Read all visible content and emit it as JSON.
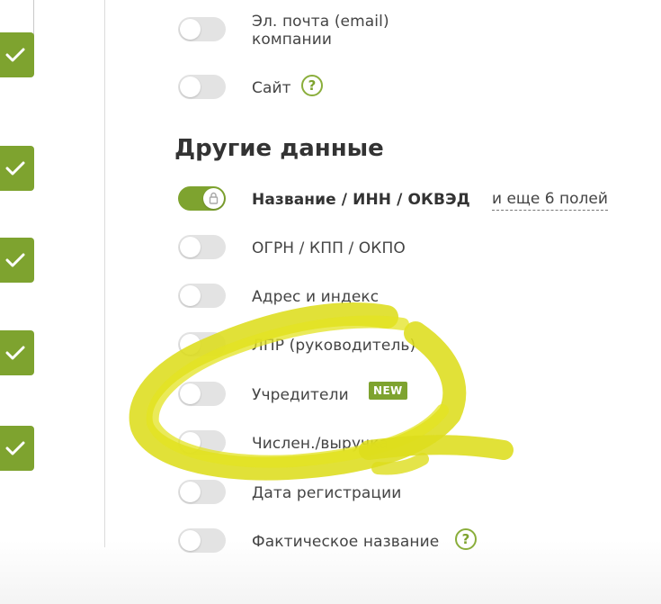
{
  "toggles_top": [
    {
      "label": "Эл. почта (email) компании",
      "on": false
    },
    {
      "label": "Сайт",
      "on": false,
      "help": "?"
    }
  ],
  "section": {
    "title": "Другие данные"
  },
  "items": [
    {
      "label": "Название / ИНН / ОКВЭД",
      "on": true,
      "locked": true
    },
    {
      "label": "ОГРН / КПП / ОКПО",
      "on": false
    },
    {
      "label": "Адрес и индекс",
      "on": false
    },
    {
      "label": "ЛПР (руководитель)",
      "on": false
    },
    {
      "label": "Учредители",
      "on": false,
      "badge": "NEW"
    },
    {
      "label": "Числен./выручка",
      "on": false
    },
    {
      "label": "Дата регистрации",
      "on": false
    },
    {
      "label": "Фактическое название",
      "on": false,
      "help": "?"
    }
  ],
  "more_fields_link": "и еще 6 полей",
  "colors": {
    "accent": "#7ea32f",
    "highlight": "#dcdc1a",
    "toggle_off": "#e3e3e3"
  },
  "icons": {
    "check": "check-icon",
    "lock": "lock-icon",
    "help": "question-icon"
  }
}
